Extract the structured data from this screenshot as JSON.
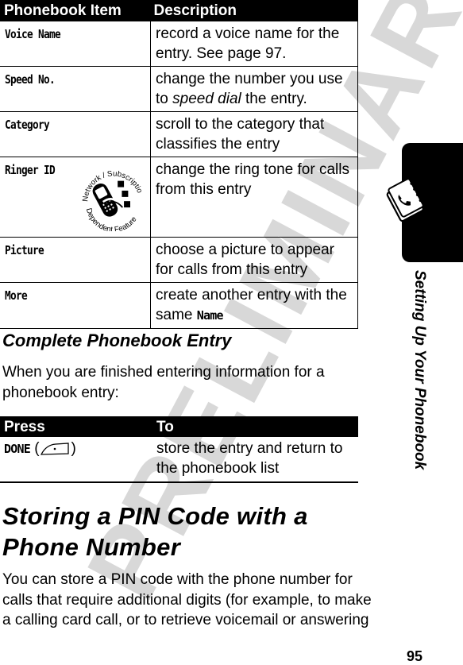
{
  "watermark": "PRELIMINARY",
  "phonebook_table": {
    "headers": [
      "Phonebook Item",
      "Description"
    ],
    "rows": [
      {
        "item": "Voice Name",
        "description": "record a voice name for the entry. See page 97."
      },
      {
        "item": "Speed No.",
        "description_pre": "change the number you use to ",
        "description_em": "speed dial",
        "description_post": " the entry."
      },
      {
        "item": "Category",
        "description": "scroll to the category that classifies the entry"
      },
      {
        "item": "Ringer ID",
        "description": "change the ring tone for calls from this entry",
        "badge": {
          "icon": "network-subscription-dependent-feature-icon",
          "text_top": "Network / Subscription",
          "text_bottom": "Dependent Feature"
        }
      },
      {
        "item": "Picture",
        "description": "choose a picture to appear for calls from this entry"
      },
      {
        "item": "More",
        "description_pre": "create another entry with the same ",
        "description_menu": "Name"
      }
    ]
  },
  "complete_section": {
    "heading": "Complete Phonebook Entry",
    "intro": "When you are finished entering information for a phonebook entry:"
  },
  "press_table": {
    "headers": [
      "Press",
      "To"
    ],
    "rows": [
      {
        "press_key": "DONE",
        "press_icon": "right-soft-key-icon",
        "to": "store the entry and return to the phonebook list"
      }
    ]
  },
  "pin_section": {
    "heading": "Storing a PIN Code with a Phone Number",
    "body": "You can store a PIN code with the phone number for calls that require additional digits (for example, to make a calling card call, or to retrieve voicemail or answering"
  },
  "side_tab": {
    "icon": "phonebook-icon",
    "title": "Setting Up Your Phonebook"
  },
  "page_number": "95"
}
